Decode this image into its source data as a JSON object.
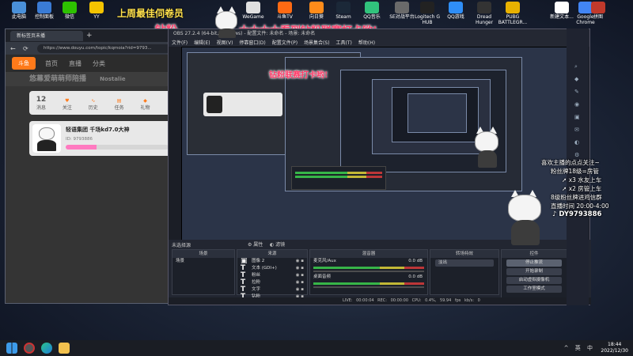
{
  "desktop": {
    "icons": [
      {
        "label": "此电脑",
        "color": "#4a90d9"
      },
      {
        "label": "控制面板",
        "color": "#3a7bd5"
      },
      {
        "label": "微信",
        "color": "#2dc100"
      },
      {
        "label": "YY",
        "color": "#f5c400"
      },
      {
        "label": "WeGame",
        "color": "#e0e0e0"
      },
      {
        "label": "斗鱼TV",
        "color": "#ff6a13"
      },
      {
        "label": "向日葵",
        "color": "#ff8c1a"
      },
      {
        "label": "Steam",
        "color": "#1b2838"
      },
      {
        "label": "QQ音乐",
        "color": "#31c27c"
      },
      {
        "label": "SE对战平台",
        "color": "#6a6a6a"
      },
      {
        "label": "Logitech G HUB",
        "color": "#222"
      },
      {
        "label": "QQ游戏",
        "color": "#2f8ef7"
      },
      {
        "label": "Dread Hunger",
        "color": "#333"
      },
      {
        "label": "PUBG BATTLEGR...",
        "color": "#e8b100"
      },
      {
        "label": "新建文本...",
        "color": "#ffffff"
      },
      {
        "label": "Google Chrome",
        "color": "#4285f4"
      },
      {
        "label": "拼图",
        "color": "#c0392b"
      }
    ]
  },
  "watermark": {
    "top_line": "上周最佳伺卷员",
    "red_line": "大大大大看到钻粉联赛打卡哟!",
    "left_fragment": "钻粉",
    "inner_fragment": "钻粉联赛打卡哟!"
  },
  "browser": {
    "tab_title": "新标签页未播",
    "url": "https://www.douyu.com/topic/kqmoia?rid=9793...",
    "logo_text": "斗鱼",
    "nav": [
      "首页",
      "直播",
      "分类"
    ],
    "banner_text": "悠幕爱萌萌师陪播",
    "banner_right": "Nostalie",
    "stats": [
      {
        "value": "12",
        "label": "消息"
      },
      {
        "value": "",
        "label": "关注"
      },
      {
        "value": "",
        "label": "历史"
      },
      {
        "value": "",
        "label": "任务"
      },
      {
        "value": "",
        "label": "礼物"
      }
    ],
    "streamer_name": "轻语集团 千场kd7.0大神",
    "streamer_sub": "ID: 9793886"
  },
  "obs": {
    "title": "OBS 27.2.4 (64-bit, windows) - 配置文件: 未命名 - 场景: 未命名",
    "menu": [
      "文件(F)",
      "编辑(E)",
      "视图(V)",
      "停靠窗口(D)",
      "配置文件(P)",
      "场景集合(S)",
      "工具(T)",
      "帮助(H)"
    ],
    "no_source": "未选择源",
    "props_button": "属性",
    "filters_button": "滤镜",
    "scenes_header": "场景",
    "scene_items": [
      "场景"
    ],
    "sources_header": "来源",
    "source_items": [
      "图像 2",
      "文本 (GDI+)",
      "粉丝",
      "拉粉",
      "文字",
      "钻粉"
    ],
    "mixer_header": "混音器",
    "mixer": [
      {
        "name": "麦克风/Aux",
        "db": "0.0 dB"
      },
      {
        "name": "桌面音频",
        "db": "0.0 dB"
      }
    ],
    "transitions_header": "转场特效",
    "transition_value": "淡出",
    "controls_header": "控件",
    "controls": [
      "停止推流",
      "开始录制",
      "启动虚拟摄像机",
      "工作室模式",
      "设置",
      "退出"
    ],
    "status": {
      "live": "LIVE: 00:00:04",
      "rec": "REC: 00:00:00",
      "cpu": "CPU: 0.4%, 59.94 fps",
      "kbps": "kb/s: 0"
    }
  },
  "chat": {
    "welcome": "喜欢主播的点点关注~",
    "lines": [
      "粉丝牌18级=房管",
      "x3 水友上车",
      "x2 房管上车",
      "8级粉丝牌进鸡信群",
      "直播时间 20:00-4:00",
      "DY9793886"
    ]
  },
  "taskbar": {
    "time": "18:44",
    "date": "2022/12/30",
    "tray_text": "^ 英 中"
  }
}
